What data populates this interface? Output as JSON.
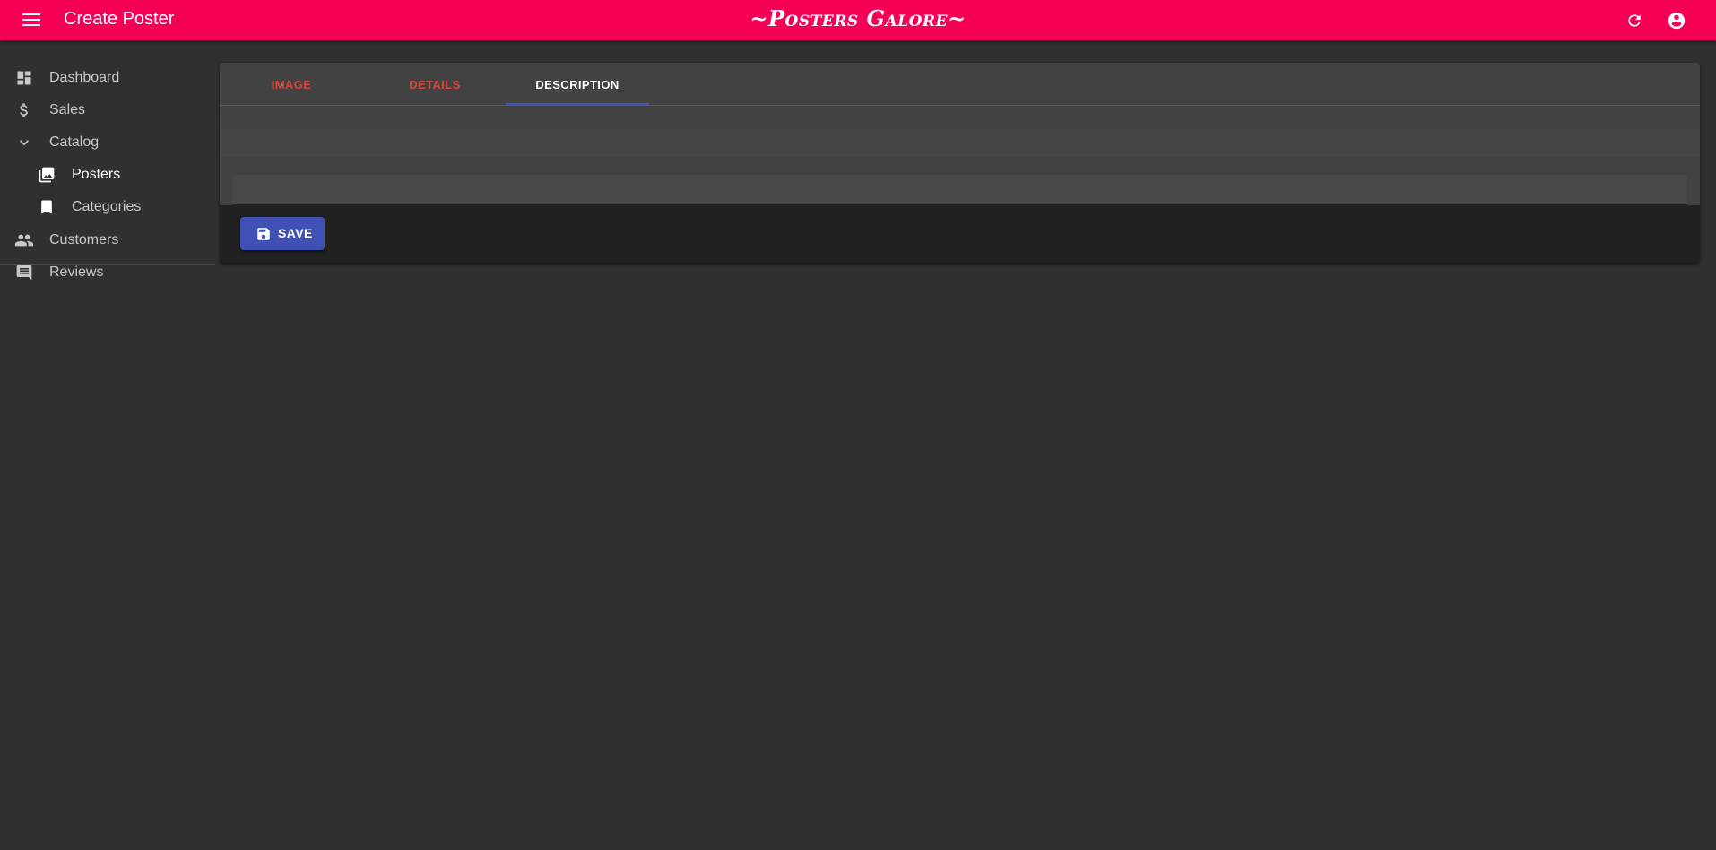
{
  "appbar": {
    "title": "Create Poster",
    "brand": "~Posters Galore~",
    "background": "#f50057",
    "icons": [
      "menu-icon",
      "refresh-icon",
      "account-circle-icon"
    ]
  },
  "sidebar": {
    "items": [
      {
        "label": "Dashboard",
        "icon": "dashboard-icon"
      },
      {
        "label": "Sales",
        "icon": "dollar-icon"
      },
      {
        "label": "Catalog",
        "icon": "chevron-down-icon"
      },
      {
        "label": "Posters",
        "icon": "collections-icon",
        "active": true
      },
      {
        "label": "Categories",
        "icon": "bookmark-icon"
      },
      {
        "label": "Customers",
        "icon": "people-icon"
      },
      {
        "label": "Reviews",
        "icon": "comment-icon"
      }
    ]
  },
  "form": {
    "tabs": [
      {
        "label": "IMAGE",
        "state": "error"
      },
      {
        "label": "DETAILS",
        "state": "error"
      },
      {
        "label": "DESCRIPTION",
        "state": "selected"
      }
    ],
    "accent": "#3f51b5",
    "error_color": "#d34a3e",
    "save_label": "SAVE"
  }
}
